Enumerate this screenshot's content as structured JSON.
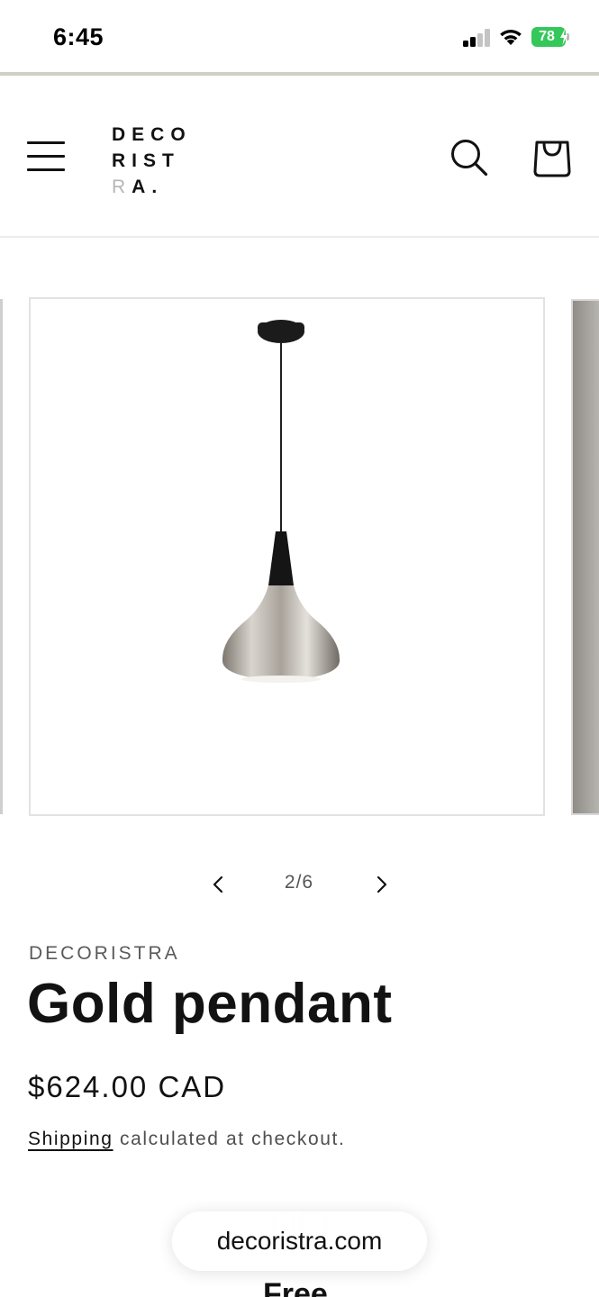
{
  "status_bar": {
    "time": "6:45",
    "battery_level": "78",
    "battery_color": "#34c759",
    "signal_icon": "cellular-signal-icon",
    "wifi_icon": "wifi-icon"
  },
  "header": {
    "logo": {
      "line1": "DECO",
      "line2": "RIST",
      "line3_faded": "R",
      "line3_rest": "A."
    },
    "menu_icon": "hamburger-menu-icon",
    "search_icon": "search-icon",
    "cart_icon": "shopping-bag-icon"
  },
  "gallery": {
    "counter": "2/6",
    "current_slide": 2,
    "total_slides": 6,
    "prev_icon": "chevron-left-icon",
    "next_icon": "chevron-right-icon"
  },
  "product": {
    "vendor": "DECORISTRA",
    "title": "Gold pendant",
    "price": "$624.00 CAD",
    "shipping_link": "Shipping",
    "shipping_rest": " calculated at checkout."
  },
  "below_fold": {
    "partial_text": "Free"
  },
  "browser": {
    "url": "decoristra.com"
  }
}
